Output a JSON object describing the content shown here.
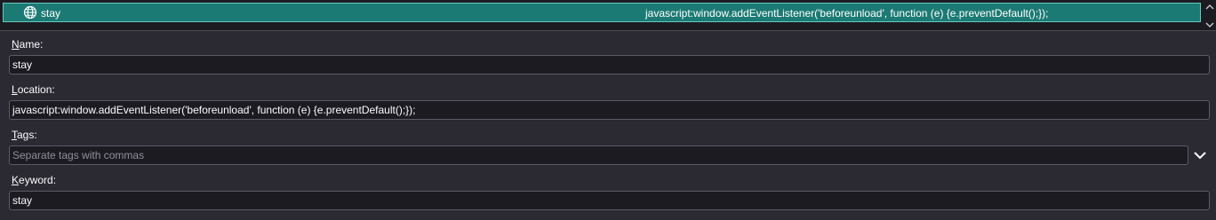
{
  "bookmark_list": {
    "selected_item": {
      "name": "stay",
      "location": "javascript:window.addEventListener('beforeunload', function (e) {e.preventDefault();});",
      "icon": "globe-icon"
    }
  },
  "form": {
    "name": {
      "label_accel": "N",
      "label_rest": "ame:",
      "value": "stay"
    },
    "location": {
      "label_accel": "L",
      "label_rest": "ocation:",
      "value": "javascript:window.addEventListener('beforeunload', function (e) {e.preventDefault();});"
    },
    "tags": {
      "label_accel": "T",
      "label_rest": "ags:",
      "placeholder": "Separate tags with commas",
      "toggle_icon": "chevron-down-icon"
    },
    "keyword": {
      "label_accel": "K",
      "label_rest": "eyword:",
      "value": "stay"
    }
  },
  "colors": {
    "selection_bg": "#1c7a74",
    "panel_bg": "#2b2a33",
    "input_bg": "#1c1b22"
  }
}
